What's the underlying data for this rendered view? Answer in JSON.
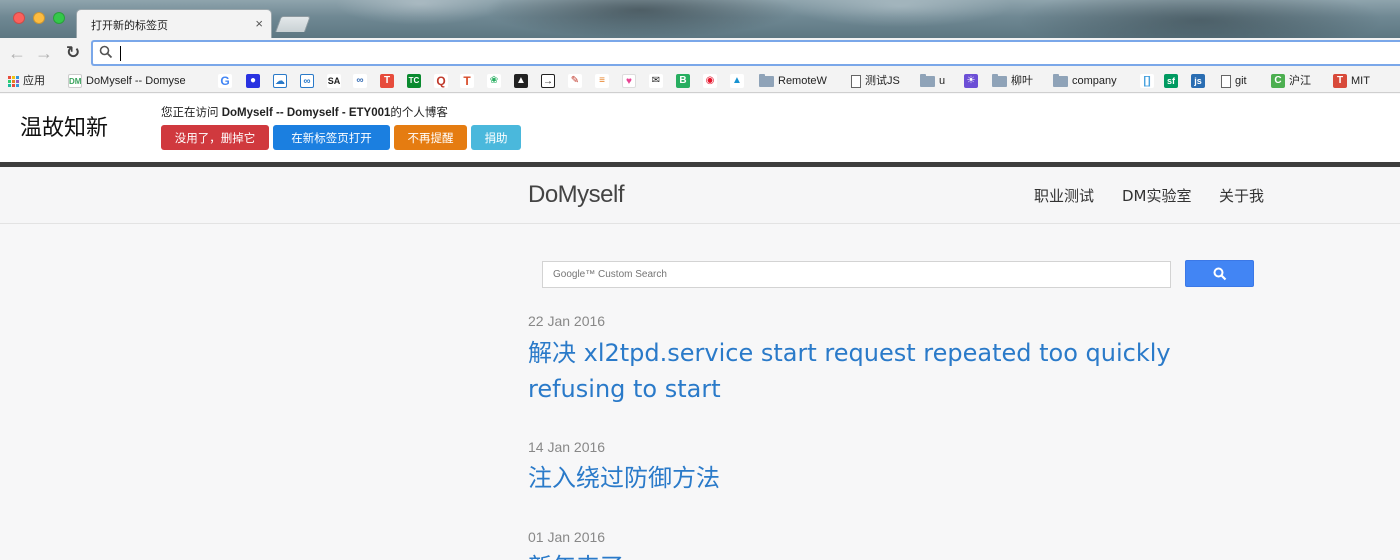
{
  "browser": {
    "tab_title": "打开新的标签页",
    "tab_close": "×",
    "address_value": ""
  },
  "bookmarks": [
    {
      "label": "应用",
      "icon": "apps-grid-icon"
    },
    {
      "label": "DoMyself -- Domyse",
      "icon": "dm-favicon-icon"
    },
    {
      "label": "",
      "icon": "google-g-icon"
    },
    {
      "label": "",
      "icon": "baidu-paw-icon"
    },
    {
      "label": "",
      "icon": "cloud-icon"
    },
    {
      "label": "",
      "icon": "cloud-icon-2"
    },
    {
      "label": "",
      "icon": "sa-icon"
    },
    {
      "label": "",
      "icon": "link-icon"
    },
    {
      "label": "",
      "icon": "t-red-icon"
    },
    {
      "label": "",
      "icon": "tc-icon"
    },
    {
      "label": "",
      "icon": "q-icon"
    },
    {
      "label": "",
      "icon": "t-icon"
    },
    {
      "label": "",
      "icon": "leaf-icon"
    },
    {
      "label": "",
      "icon": "mountain-icon"
    },
    {
      "label": "",
      "icon": "arrow-box-icon"
    },
    {
      "label": "",
      "icon": "pen-icon"
    },
    {
      "label": "",
      "icon": "stack-icon"
    },
    {
      "label": "",
      "icon": "hello-kitty-icon"
    },
    {
      "label": "",
      "icon": "mail-icon"
    },
    {
      "label": "",
      "icon": "b-green-icon"
    },
    {
      "label": "",
      "icon": "weibo-icon"
    },
    {
      "label": "",
      "icon": "arch-icon"
    },
    {
      "label": "RemoteW",
      "icon": "folder-icon"
    },
    {
      "label": "测试JS",
      "icon": "page-icon"
    },
    {
      "label": "u",
      "icon": "folder-icon"
    },
    {
      "label": "",
      "icon": "purple-app-icon"
    },
    {
      "label": "柳叶",
      "icon": "folder-icon"
    },
    {
      "label": "company",
      "icon": "folder-icon"
    },
    {
      "label": "",
      "icon": "bracket-icon"
    },
    {
      "label": "",
      "icon": "sf-icon"
    },
    {
      "label": "",
      "icon": "js-icon"
    },
    {
      "label": "git",
      "icon": "page-icon"
    },
    {
      "label": "沪江",
      "icon": "hujiang-icon"
    },
    {
      "label": "MIT",
      "icon": "mit-t-icon"
    }
  ],
  "notice": {
    "brand": "温故知新",
    "message_prefix": "您正在访问 ",
    "message_site": "DoMyself -- Domyself - ETY001",
    "message_suffix": "的个人博客",
    "btn_delete": "没用了，删掉它",
    "btn_open": "在新标签页打开",
    "btn_no_remind": "不再提醒",
    "btn_donate": "捐助"
  },
  "site": {
    "logo": "DoMyself",
    "nav": [
      "职业测试",
      "DM实验室",
      "关于我"
    ],
    "search_placeholder": "Google™ Custom Search"
  },
  "posts": [
    {
      "date": "22 Jan 2016",
      "title": "解决 xl2tpd.service start request repeated too quickly refusing to start"
    },
    {
      "date": "14 Jan 2016",
      "title": "注入绕过防御方法"
    },
    {
      "date": "01 Jan 2016",
      "title": "新年来了"
    }
  ],
  "colors": {
    "accent_link": "#2a7ac9",
    "btn_red": "#d0393e",
    "btn_blue": "#1b7fe0",
    "btn_orange": "#e57c11",
    "btn_cyan": "#4ab8dc",
    "search_button": "#4285f4"
  }
}
